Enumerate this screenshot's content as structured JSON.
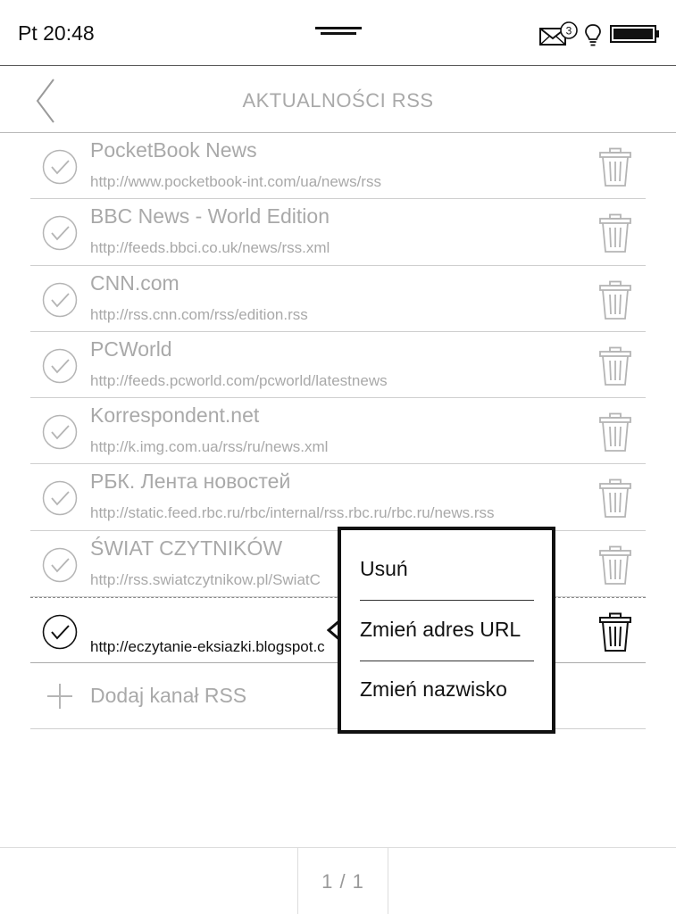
{
  "status_bar": {
    "time": "Pt 20:48",
    "mail_badge": "3",
    "icons": [
      "menu-handle-icon",
      "mail-icon",
      "bulb-icon",
      "battery-icon"
    ]
  },
  "header": {
    "title": "AKTUALNOŚCI RSS",
    "back_icon": "chevron-left-icon"
  },
  "feeds": [
    {
      "name": "PocketBook News",
      "url": "http://www.pocketbook-int.com/ua/news/rss"
    },
    {
      "name": "BBC News - World Edition",
      "url": "http://feeds.bbci.co.uk/news/rss.xml"
    },
    {
      "name": "CNN.com",
      "url": "http://rss.cnn.com/rss/edition.rss"
    },
    {
      "name": "PCWorld",
      "url": "http://feeds.pcworld.com/pcworld/latestnews"
    },
    {
      "name": "Korrespondent.net",
      "url": "http://k.img.com.ua/rss/ru/news.xml"
    },
    {
      "name": "РБК. Лента новостей",
      "url": "http://static.feed.rbc.ru/rbc/internal/rss.rbc.ru/rbc.ru/news.rss"
    },
    {
      "name": "ŚWIAT CZYTNIKÓW",
      "url": "http://rss.swiatczytnikow.pl/SwiatC"
    },
    {
      "name": "",
      "url": "http://eczytanie-eksiazki.blogspot.c"
    }
  ],
  "add_feed": {
    "label": "Dodaj kanał RSS"
  },
  "context_menu": {
    "items": [
      "Usuń",
      "Zmień adres URL",
      "Zmień nazwisko"
    ]
  },
  "footer": {
    "page_indicator": "1 / 1"
  },
  "colors": {
    "text": "#111111",
    "muted": "#a9a9a9",
    "divider": "#cfcfcf"
  }
}
